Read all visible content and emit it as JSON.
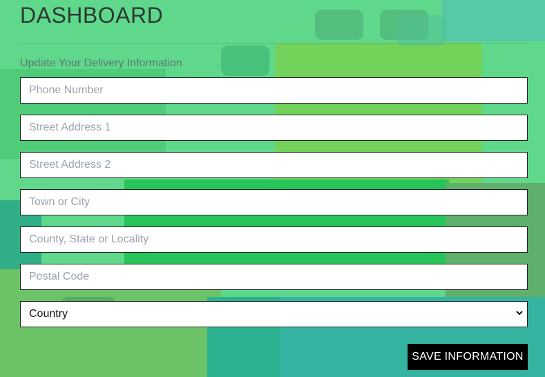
{
  "page": {
    "title": "DASHBOARD",
    "subtitle": "Update Your Delivery Information"
  },
  "form": {
    "phone": {
      "placeholder": "Phone Number",
      "value": ""
    },
    "street1": {
      "placeholder": "Street Address 1",
      "value": ""
    },
    "street2": {
      "placeholder": "Street Address 2",
      "value": ""
    },
    "town": {
      "placeholder": "Town or City",
      "value": ""
    },
    "county": {
      "placeholder": "County, State or Locality",
      "value": ""
    },
    "postal": {
      "placeholder": "Postal Code",
      "value": ""
    },
    "country": {
      "selected": "Country"
    },
    "save_label": "SAVE INFORMATION"
  },
  "icons": {
    "country_dropdown": "chevron-down-icon"
  },
  "colors": {
    "button_bg": "#000000",
    "button_text": "#ffffff",
    "field_border": "#222222",
    "background": "#5fd88c"
  }
}
